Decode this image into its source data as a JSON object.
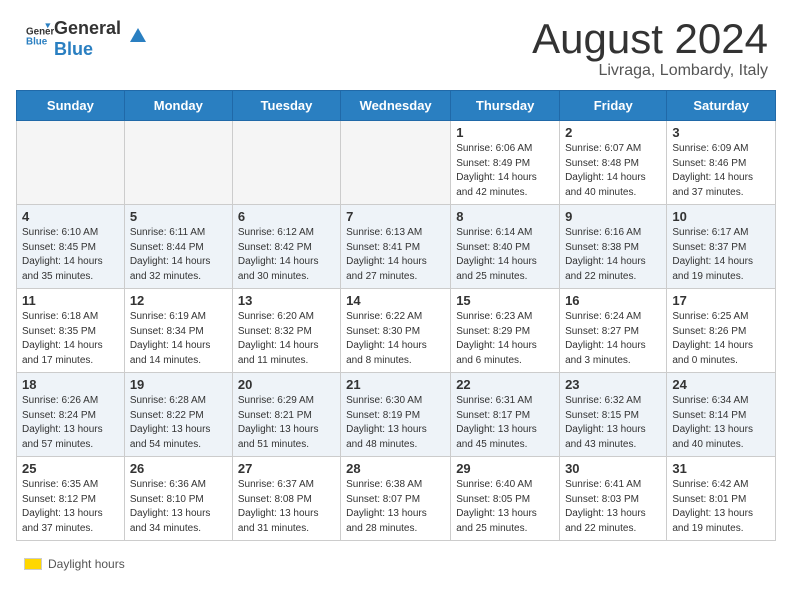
{
  "header": {
    "logo_general": "General",
    "logo_blue": "Blue",
    "month_title": "August 2024",
    "location": "Livraga, Lombardy, Italy"
  },
  "weekdays": [
    "Sunday",
    "Monday",
    "Tuesday",
    "Wednesday",
    "Thursday",
    "Friday",
    "Saturday"
  ],
  "weeks": [
    [
      {
        "day": "",
        "info": ""
      },
      {
        "day": "",
        "info": ""
      },
      {
        "day": "",
        "info": ""
      },
      {
        "day": "",
        "info": ""
      },
      {
        "day": "1",
        "info": "Sunrise: 6:06 AM\nSunset: 8:49 PM\nDaylight: 14 hours\nand 42 minutes."
      },
      {
        "day": "2",
        "info": "Sunrise: 6:07 AM\nSunset: 8:48 PM\nDaylight: 14 hours\nand 40 minutes."
      },
      {
        "day": "3",
        "info": "Sunrise: 6:09 AM\nSunset: 8:46 PM\nDaylight: 14 hours\nand 37 minutes."
      }
    ],
    [
      {
        "day": "4",
        "info": "Sunrise: 6:10 AM\nSunset: 8:45 PM\nDaylight: 14 hours\nand 35 minutes."
      },
      {
        "day": "5",
        "info": "Sunrise: 6:11 AM\nSunset: 8:44 PM\nDaylight: 14 hours\nand 32 minutes."
      },
      {
        "day": "6",
        "info": "Sunrise: 6:12 AM\nSunset: 8:42 PM\nDaylight: 14 hours\nand 30 minutes."
      },
      {
        "day": "7",
        "info": "Sunrise: 6:13 AM\nSunset: 8:41 PM\nDaylight: 14 hours\nand 27 minutes."
      },
      {
        "day": "8",
        "info": "Sunrise: 6:14 AM\nSunset: 8:40 PM\nDaylight: 14 hours\nand 25 minutes."
      },
      {
        "day": "9",
        "info": "Sunrise: 6:16 AM\nSunset: 8:38 PM\nDaylight: 14 hours\nand 22 minutes."
      },
      {
        "day": "10",
        "info": "Sunrise: 6:17 AM\nSunset: 8:37 PM\nDaylight: 14 hours\nand 19 minutes."
      }
    ],
    [
      {
        "day": "11",
        "info": "Sunrise: 6:18 AM\nSunset: 8:35 PM\nDaylight: 14 hours\nand 17 minutes."
      },
      {
        "day": "12",
        "info": "Sunrise: 6:19 AM\nSunset: 8:34 PM\nDaylight: 14 hours\nand 14 minutes."
      },
      {
        "day": "13",
        "info": "Sunrise: 6:20 AM\nSunset: 8:32 PM\nDaylight: 14 hours\nand 11 minutes."
      },
      {
        "day": "14",
        "info": "Sunrise: 6:22 AM\nSunset: 8:30 PM\nDaylight: 14 hours\nand 8 minutes."
      },
      {
        "day": "15",
        "info": "Sunrise: 6:23 AM\nSunset: 8:29 PM\nDaylight: 14 hours\nand 6 minutes."
      },
      {
        "day": "16",
        "info": "Sunrise: 6:24 AM\nSunset: 8:27 PM\nDaylight: 14 hours\nand 3 minutes."
      },
      {
        "day": "17",
        "info": "Sunrise: 6:25 AM\nSunset: 8:26 PM\nDaylight: 14 hours\nand 0 minutes."
      }
    ],
    [
      {
        "day": "18",
        "info": "Sunrise: 6:26 AM\nSunset: 8:24 PM\nDaylight: 13 hours\nand 57 minutes."
      },
      {
        "day": "19",
        "info": "Sunrise: 6:28 AM\nSunset: 8:22 PM\nDaylight: 13 hours\nand 54 minutes."
      },
      {
        "day": "20",
        "info": "Sunrise: 6:29 AM\nSunset: 8:21 PM\nDaylight: 13 hours\nand 51 minutes."
      },
      {
        "day": "21",
        "info": "Sunrise: 6:30 AM\nSunset: 8:19 PM\nDaylight: 13 hours\nand 48 minutes."
      },
      {
        "day": "22",
        "info": "Sunrise: 6:31 AM\nSunset: 8:17 PM\nDaylight: 13 hours\nand 45 minutes."
      },
      {
        "day": "23",
        "info": "Sunrise: 6:32 AM\nSunset: 8:15 PM\nDaylight: 13 hours\nand 43 minutes."
      },
      {
        "day": "24",
        "info": "Sunrise: 6:34 AM\nSunset: 8:14 PM\nDaylight: 13 hours\nand 40 minutes."
      }
    ],
    [
      {
        "day": "25",
        "info": "Sunrise: 6:35 AM\nSunset: 8:12 PM\nDaylight: 13 hours\nand 37 minutes."
      },
      {
        "day": "26",
        "info": "Sunrise: 6:36 AM\nSunset: 8:10 PM\nDaylight: 13 hours\nand 34 minutes."
      },
      {
        "day": "27",
        "info": "Sunrise: 6:37 AM\nSunset: 8:08 PM\nDaylight: 13 hours\nand 31 minutes."
      },
      {
        "day": "28",
        "info": "Sunrise: 6:38 AM\nSunset: 8:07 PM\nDaylight: 13 hours\nand 28 minutes."
      },
      {
        "day": "29",
        "info": "Sunrise: 6:40 AM\nSunset: 8:05 PM\nDaylight: 13 hours\nand 25 minutes."
      },
      {
        "day": "30",
        "info": "Sunrise: 6:41 AM\nSunset: 8:03 PM\nDaylight: 13 hours\nand 22 minutes."
      },
      {
        "day": "31",
        "info": "Sunrise: 6:42 AM\nSunset: 8:01 PM\nDaylight: 13 hours\nand 19 minutes."
      }
    ]
  ],
  "legend": {
    "label": "Daylight hours"
  }
}
